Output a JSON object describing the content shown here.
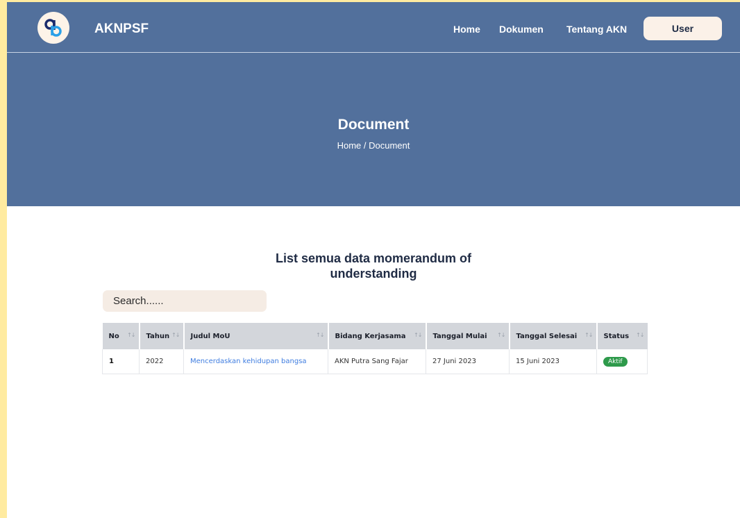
{
  "navbar": {
    "brand": "AKNPSF",
    "links": [
      "Home",
      "Dokumen",
      "Tentang AKN"
    ],
    "user_button": "User"
  },
  "hero": {
    "title": "Document",
    "breadcrumb": "Home / Document"
  },
  "content": {
    "title_line1": "List semua data momerandum of",
    "title_line2": "understanding",
    "search_placeholder": "Search......"
  },
  "table": {
    "headers": [
      "No",
      "Tahun",
      "Judul MoU",
      "Bidang Kerjasama",
      "Tanggal Mulai",
      "Tanggal Selesai",
      "Status"
    ],
    "rows": [
      {
        "no": "1",
        "tahun": "2022",
        "judul": "Mencerdaskan kehidupan bangsa",
        "bidang": "AKN Putra Sang Fajar",
        "mulai": "27 Juni 2023",
        "selesai": "15 Juni 2023",
        "status": "Aktif"
      }
    ]
  },
  "colors": {
    "header_bg": "#52709c",
    "badge_green": "#2e9a4b",
    "link_blue": "#3f7de0"
  },
  "icons": {
    "logo": "logo-icon",
    "sort": "sort-icon"
  }
}
